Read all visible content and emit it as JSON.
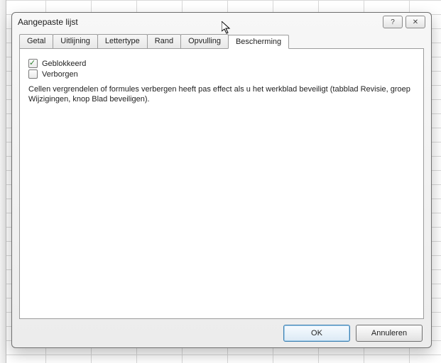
{
  "dialog": {
    "title": "Aangepaste lijst"
  },
  "tabs": {
    "getal": "Getal",
    "uitlijning": "Uitlijning",
    "lettertype": "Lettertype",
    "rand": "Rand",
    "opvulling": "Opvulling",
    "bescherming": "Bescherming"
  },
  "protection": {
    "locked_label": "Geblokkeerd",
    "hidden_label": "Verborgen",
    "description": "Cellen vergrendelen of formules verbergen heeft pas effect als u het werkblad beveiligt (tabblad Revisie, groep Wijzigingen, knop Blad beveiligen)."
  },
  "buttons": {
    "ok": "OK",
    "cancel": "Annuleren"
  }
}
